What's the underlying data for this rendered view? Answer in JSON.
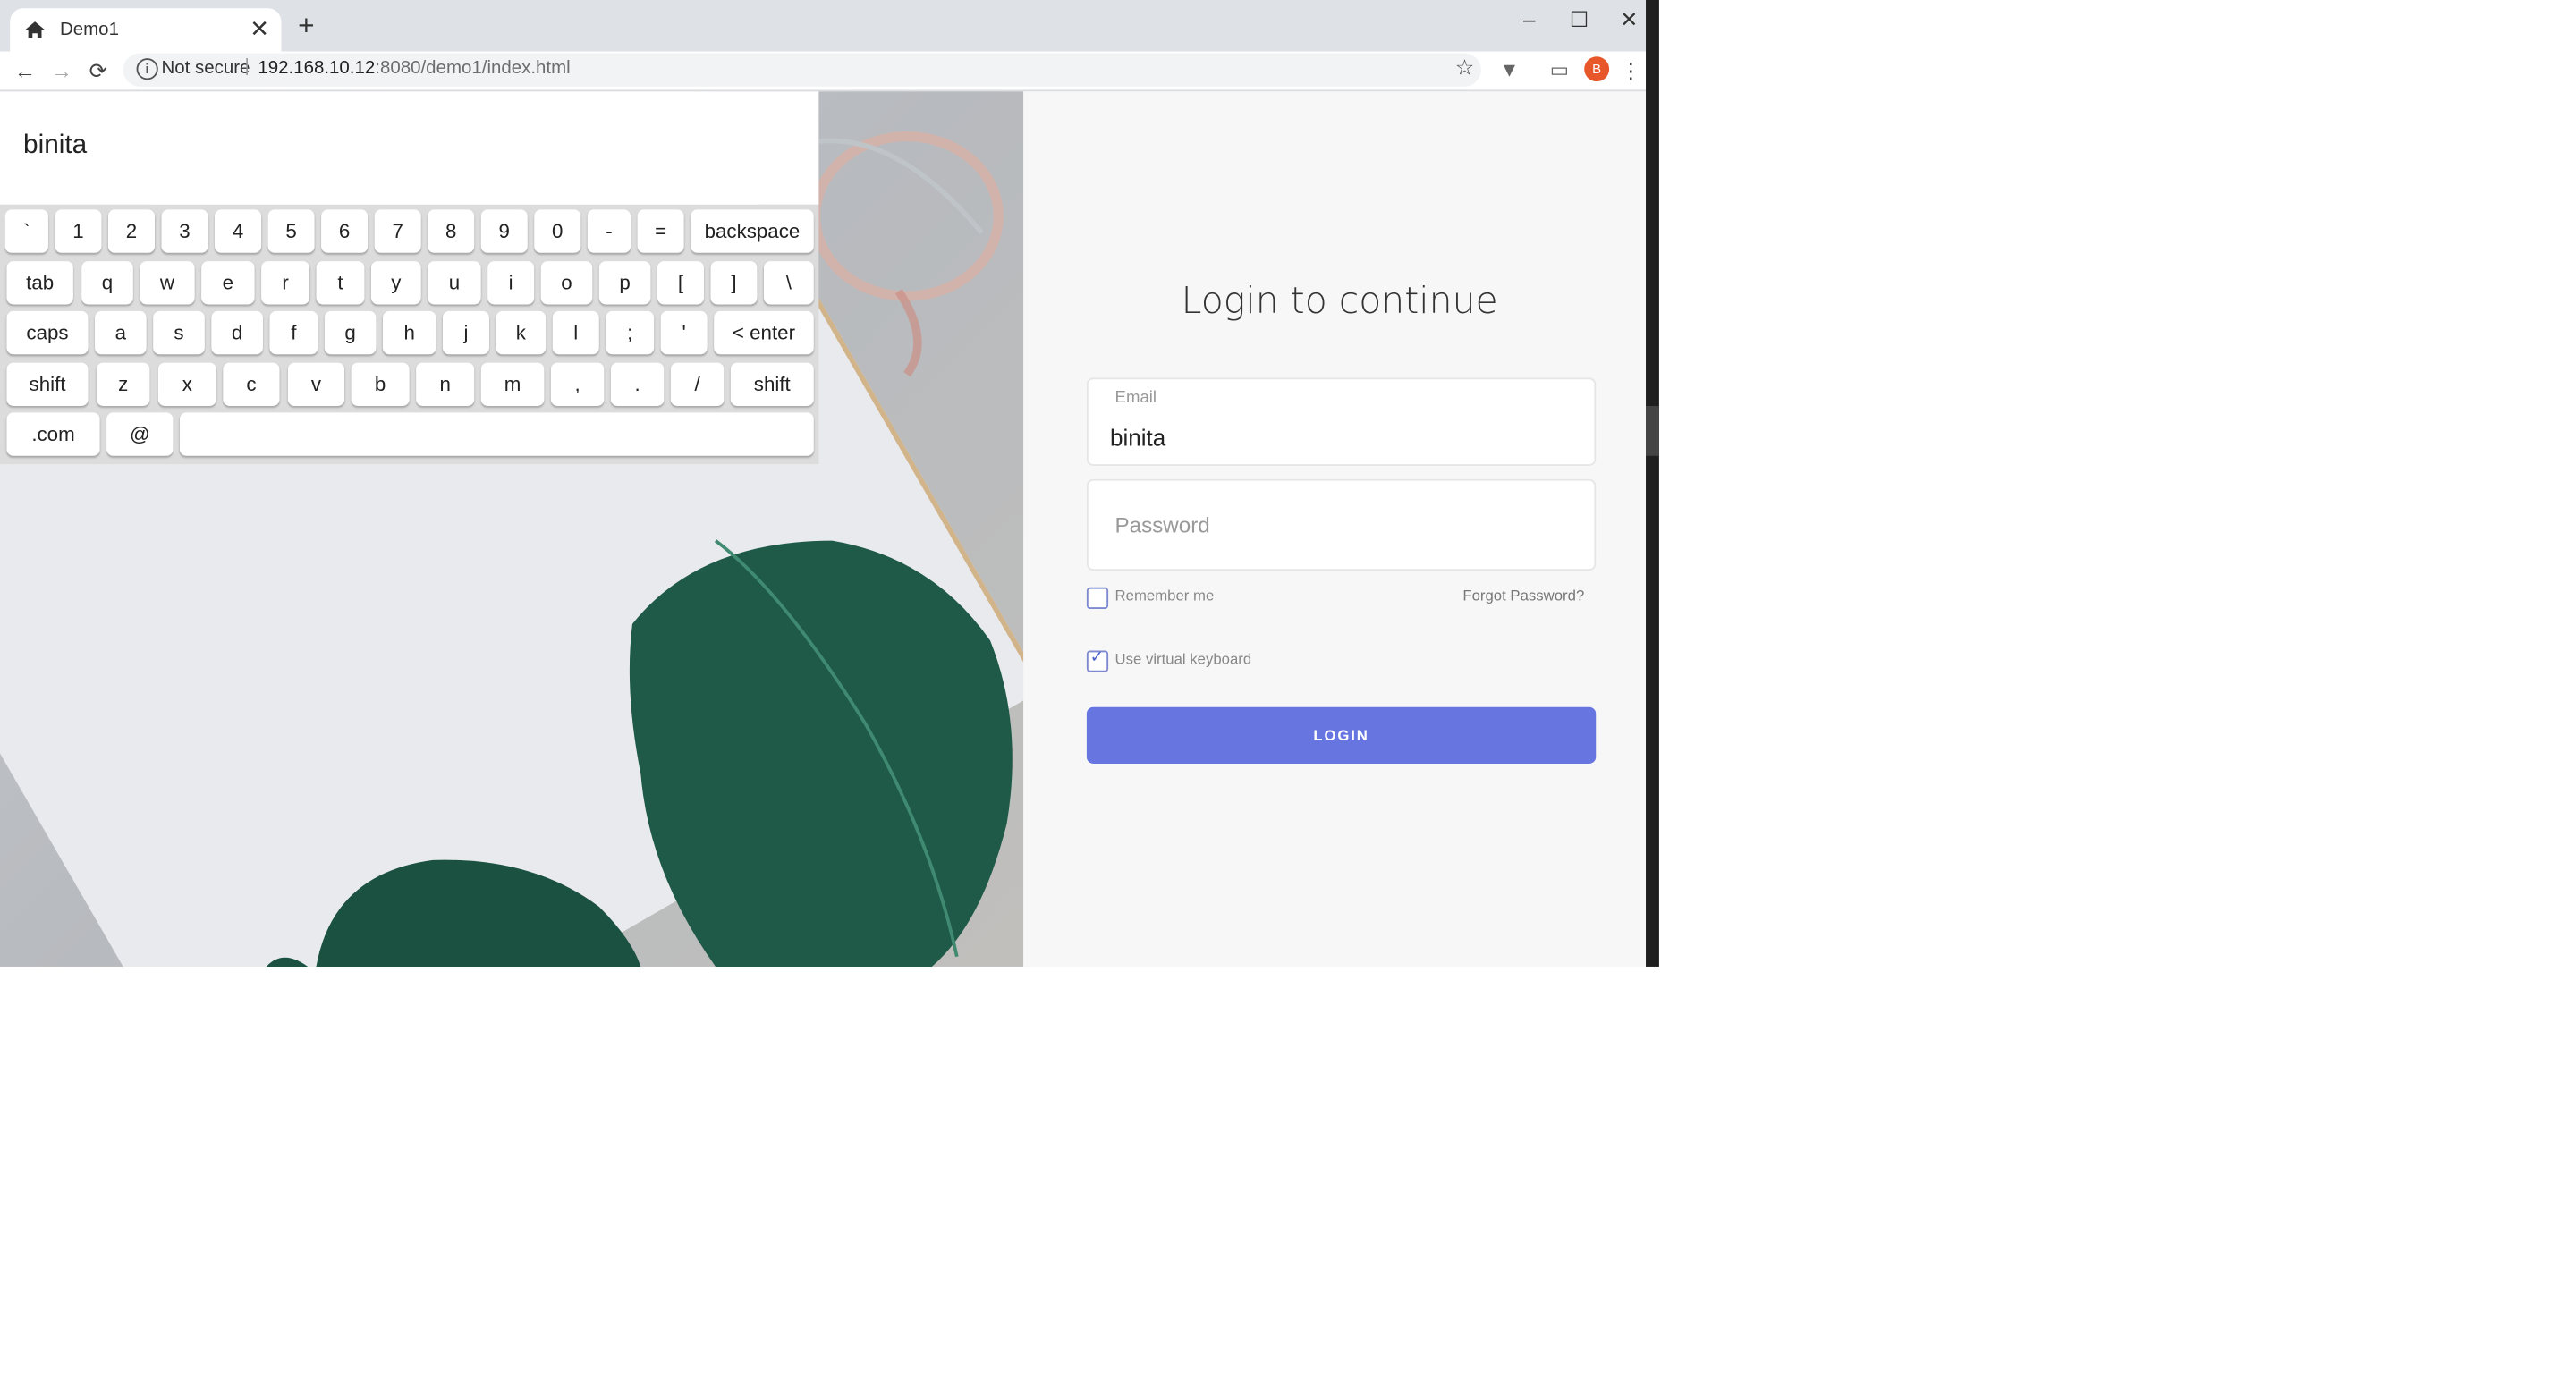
{
  "browser": {
    "tab_title": "Demo1",
    "new_tab": "+",
    "window_controls": {
      "minimize": "–",
      "maximize": "☐",
      "close": "✕"
    },
    "nav": {
      "back": "←",
      "forward": "→",
      "reload": "⟳"
    },
    "security_text": "Not secure",
    "separator": "|",
    "url_host": "192.168.10.12",
    "url_rest": ":8080/demo1/index.html",
    "star": "☆",
    "avatar_letter": "B",
    "menu": "⋮",
    "icons": [
      "home-icon",
      "close-icon",
      "plus-icon",
      "minimize-icon",
      "maximize-icon",
      "back-arrow-icon",
      "forward-arrow-icon",
      "reload-icon",
      "info-icon",
      "star-icon",
      "extension-icon",
      "cast-icon",
      "kebab-menu-icon"
    ]
  },
  "keyboard": {
    "display_value": "binita",
    "rows": [
      [
        "`",
        "1",
        "2",
        "3",
        "4",
        "5",
        "6",
        "7",
        "8",
        "9",
        "0",
        "-",
        "=",
        "backspace"
      ],
      [
        "tab",
        "q",
        "w",
        "e",
        "r",
        "t",
        "y",
        "u",
        "i",
        "o",
        "p",
        "[",
        "]",
        "\\"
      ],
      [
        "caps",
        "a",
        "s",
        "d",
        "f",
        "g",
        "h",
        "j",
        "k",
        "l",
        ";",
        "'",
        "< enter"
      ],
      [
        "shift",
        "z",
        "x",
        "c",
        "v",
        "b",
        "n",
        "m",
        ",",
        ".",
        "/",
        "shift"
      ],
      [
        ".com",
        "@",
        ""
      ]
    ]
  },
  "login": {
    "heading": "Login to continue",
    "email_label": "Email",
    "email_value": "binita",
    "password_placeholder": "Password",
    "remember_label": "Remember me",
    "remember_checked": false,
    "forgot_label": "Forgot Password?",
    "vk_label": "Use virtual keyboard",
    "vk_checked": true,
    "login_button": "LOGIN"
  },
  "colors": {
    "accent": "#6675e0",
    "avatar": "#e8572a",
    "tabbar": "#dee1e6"
  }
}
